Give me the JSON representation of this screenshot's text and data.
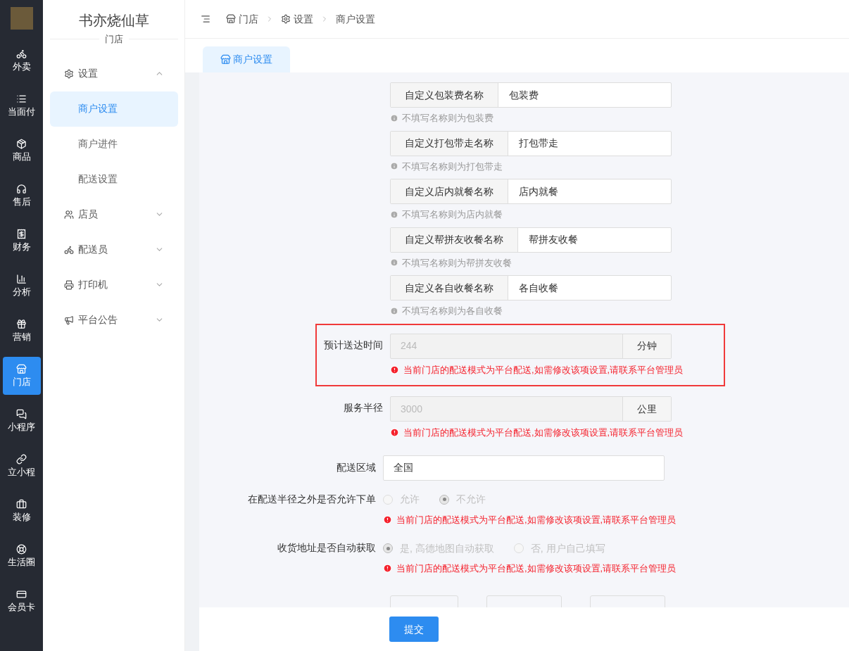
{
  "rail": {
    "items": [
      {
        "label": "外卖",
        "selected": false
      },
      {
        "label": "当面付",
        "selected": false
      },
      {
        "label": "商品",
        "selected": false
      },
      {
        "label": "售后",
        "selected": false
      },
      {
        "label": "财务",
        "selected": false
      },
      {
        "label": "分析",
        "selected": false
      },
      {
        "label": "营销",
        "selected": false
      },
      {
        "label": "门店",
        "selected": true
      },
      {
        "label": "小程序",
        "selected": false
      },
      {
        "label": "立小程",
        "selected": false
      },
      {
        "label": "装修",
        "selected": false
      },
      {
        "label": "生活圈",
        "selected": false
      },
      {
        "label": "会员卡",
        "selected": false
      }
    ]
  },
  "sidebar": {
    "title": "书亦烧仙草",
    "subtitle": "门店",
    "menu": [
      {
        "label": "设置",
        "expanded": true,
        "children": [
          {
            "label": "商户设置",
            "selected": true
          },
          {
            "label": "商户进件",
            "selected": false
          },
          {
            "label": "配送设置",
            "selected": false
          }
        ]
      },
      {
        "label": "店员",
        "expanded": false
      },
      {
        "label": "配送员",
        "expanded": false
      },
      {
        "label": "打印机",
        "expanded": false
      },
      {
        "label": "平台公告",
        "expanded": false
      }
    ]
  },
  "breadcrumb": [
    {
      "label": "门店"
    },
    {
      "label": "设置"
    },
    {
      "label": "商户设置"
    }
  ],
  "tabs": [
    {
      "label": "商户设置",
      "selected": true
    }
  ],
  "form": [
    {
      "kind": "addon",
      "addon": "自定义包装费名称",
      "value": "包装费",
      "hint": "不填写名称则为包装费"
    },
    {
      "kind": "addon",
      "addon": "自定义打包带走名称",
      "value": "打包带走",
      "hint": "不填写名称则为打包带走"
    },
    {
      "kind": "addon",
      "addon": "自定义店内就餐名称",
      "value": "店内就餐",
      "hint": "不填写名称则为店内就餐"
    },
    {
      "kind": "addon",
      "addon": "自定义帮拼友收餐名称",
      "value": "帮拼友收餐",
      "hint": "不填写名称则为帮拼友收餐"
    },
    {
      "kind": "addon",
      "addon": "自定义各自收餐名称",
      "value": "各自收餐",
      "hint": "不填写名称则为各自收餐"
    },
    {
      "kind": "unit",
      "label": "预计送达时间",
      "value": "244",
      "unit": "分钟",
      "disabled": true,
      "highlighted": true,
      "warning": "当前门店的配送模式为平台配送,如需修改该项设置,请联系平台管理员"
    },
    {
      "kind": "unit",
      "label": "服务半径",
      "value": "3000",
      "unit": "公里",
      "disabled": true,
      "highlighted": false,
      "warning": "当前门店的配送模式为平台配送,如需修改该项设置,请联系平台管理员"
    },
    {
      "kind": "text",
      "label": "配送区域",
      "value": "全国"
    },
    {
      "kind": "radio",
      "label": "在配送半径之外是否允许下单",
      "disabled": true,
      "options": [
        {
          "label": "允许",
          "selected": false
        },
        {
          "label": "不允许",
          "selected": true
        }
      ],
      "warning": "当前门店的配送模式为平台配送,如需修改该项设置,请联系平台管理员"
    },
    {
      "kind": "radio",
      "label": "收货地址是否自动获取",
      "disabled": true,
      "options": [
        {
          "label": "是, 高德地图自动获取",
          "selected": true
        },
        {
          "label": "否, 用户自己填写",
          "selected": false
        }
      ],
      "warning": "当前门店的配送模式为平台配送,如需修改该项设置,请联系平台管理员"
    }
  ],
  "submit": "提交"
}
